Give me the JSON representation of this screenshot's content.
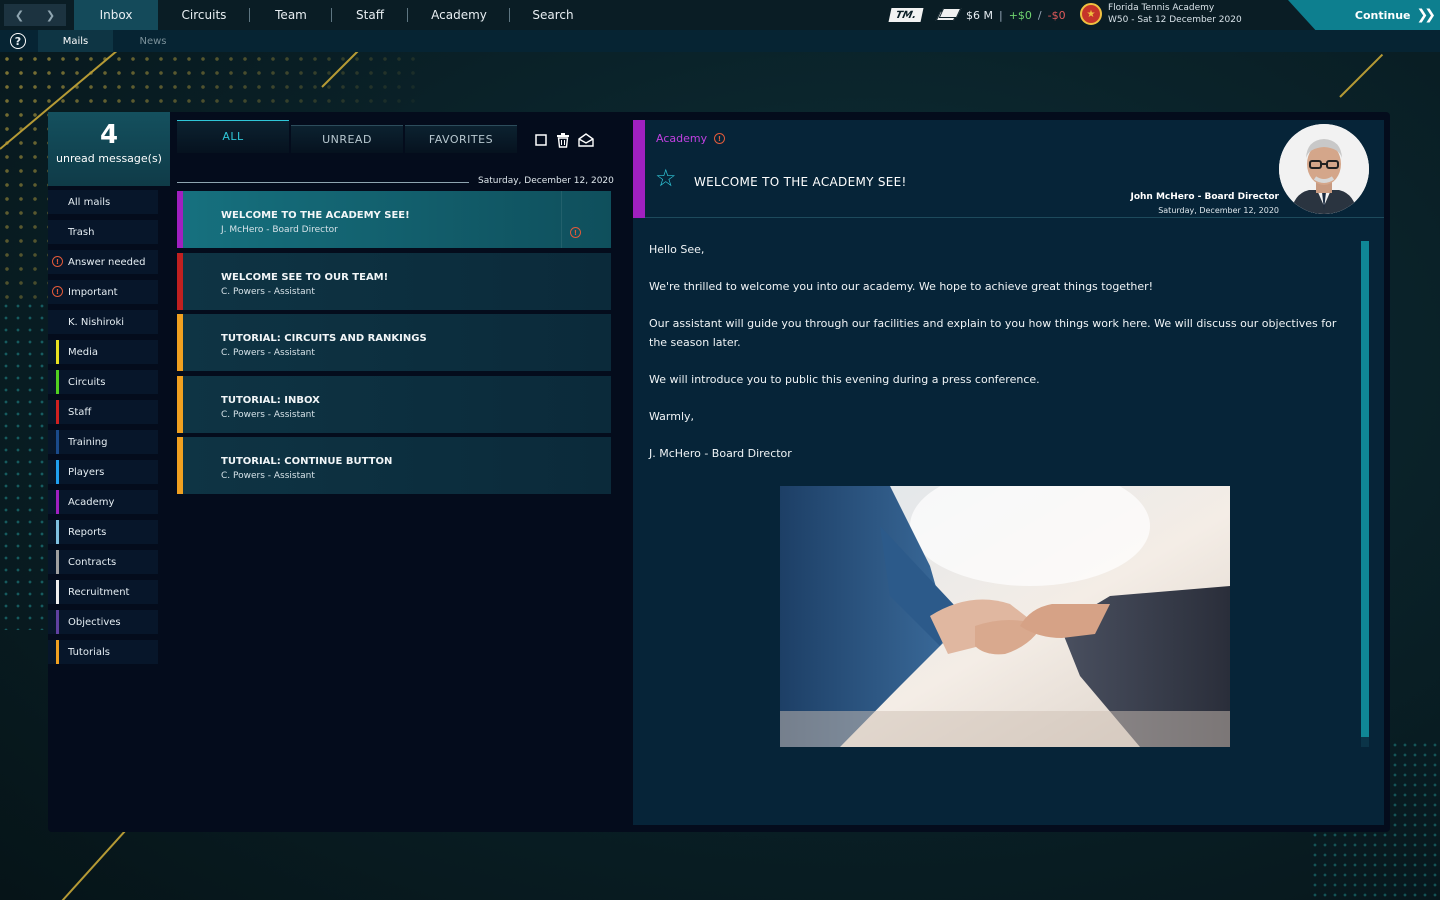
{
  "topnav": {
    "tabs": [
      {
        "label": "Inbox",
        "active": true
      },
      {
        "label": "Circuits"
      },
      {
        "label": "Team"
      },
      {
        "label": "Staff"
      },
      {
        "label": "Academy"
      },
      {
        "label": "Search"
      }
    ],
    "logo_text": "TM.",
    "money": {
      "balance": "$6 M",
      "divider": "|",
      "income": "+$0",
      "slash": "/",
      "expense": "-$0"
    },
    "club": {
      "name": "Florida Tennis Academy",
      "date": "W50 - Sat 12 December 2020"
    },
    "continue_label": "Continue"
  },
  "subnav": {
    "tabs": [
      {
        "label": "Mails",
        "active": true
      },
      {
        "label": "News"
      }
    ]
  },
  "unread": {
    "count": "4",
    "label": "unread message(s)"
  },
  "folders": [
    {
      "label": "All mails",
      "color": ""
    },
    {
      "label": "Trash",
      "color": ""
    },
    {
      "label": "Answer needed",
      "color": "",
      "warn": true
    },
    {
      "label": "Important",
      "color": "",
      "warn": true
    },
    {
      "label": "K. Nishiroki",
      "color": ""
    },
    {
      "label": "Media",
      "color": "#e8e020"
    },
    {
      "label": "Circuits",
      "color": "#50d020"
    },
    {
      "label": "Staff",
      "color": "#d02020"
    },
    {
      "label": "Training",
      "color": "#1a4a8a"
    },
    {
      "label": "Players",
      "color": "#20a0f0"
    },
    {
      "label": "Academy",
      "color": "#a020c0"
    },
    {
      "label": "Reports",
      "color": "#80c0e0"
    },
    {
      "label": "Contracts",
      "color": "#a0a0a0"
    },
    {
      "label": "Recruitment",
      "color": "#f0f0f0"
    },
    {
      "label": "Objectives",
      "color": "#6040a0"
    },
    {
      "label": "Tutorials",
      "color": "#f0a020"
    }
  ],
  "filters": {
    "all": "ALL",
    "unread": "UNREAD",
    "favorites": "FAVORITES"
  },
  "list": {
    "date": "Saturday, December 12, 2020",
    "mails": [
      {
        "subject": "WELCOME TO THE ACADEMY SEE!",
        "from": "J. McHero - Board Director",
        "color": "#a020c0",
        "selected": true,
        "warn": true
      },
      {
        "subject": "WELCOME SEE TO OUR TEAM!",
        "from": "C. Powers - Assistant",
        "color": "#c02020"
      },
      {
        "subject": "TUTORIAL: CIRCUITS AND RANKINGS",
        "from": "C. Powers - Assistant",
        "color": "#f0a020"
      },
      {
        "subject": "TUTORIAL: INBOX",
        "from": "C. Powers - Assistant",
        "color": "#f0a020"
      },
      {
        "subject": "TUTORIAL: CONTINUE BUTTON",
        "from": "C. Powers - Assistant",
        "color": "#f0a020"
      }
    ]
  },
  "detail": {
    "category": "Academy",
    "title": "WELCOME TO THE ACADEMY SEE!",
    "sender": "John McHero - Board Director",
    "date": "Saturday, December 12, 2020",
    "body": [
      "Hello See,",
      "We're thrilled to welcome you into our academy. We hope to achieve great things together!",
      "Our assistant will guide you through our facilities and explain to you how things work here. We will discuss our objectives for the season later.",
      "We will introduce you to public this evening during a press conference.",
      "Warmly,",
      "J. McHero - Board Director"
    ]
  }
}
